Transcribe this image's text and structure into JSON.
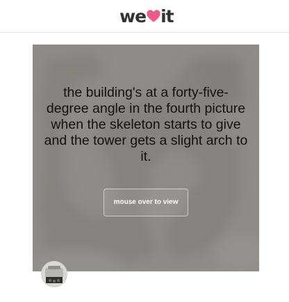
{
  "header": {
    "logo_text_left": "we",
    "logo_text_right": "it",
    "brand_color": "#f05a8b"
  },
  "card": {
    "quote": "the building's at a forty-five-degree angle in the fourth picture when the skeleton starts to give and the tower gets a slight arch to it.",
    "mouse_over_label": "mouse over to view"
  },
  "user": {
    "avatar_icon": "avatar-icon"
  }
}
